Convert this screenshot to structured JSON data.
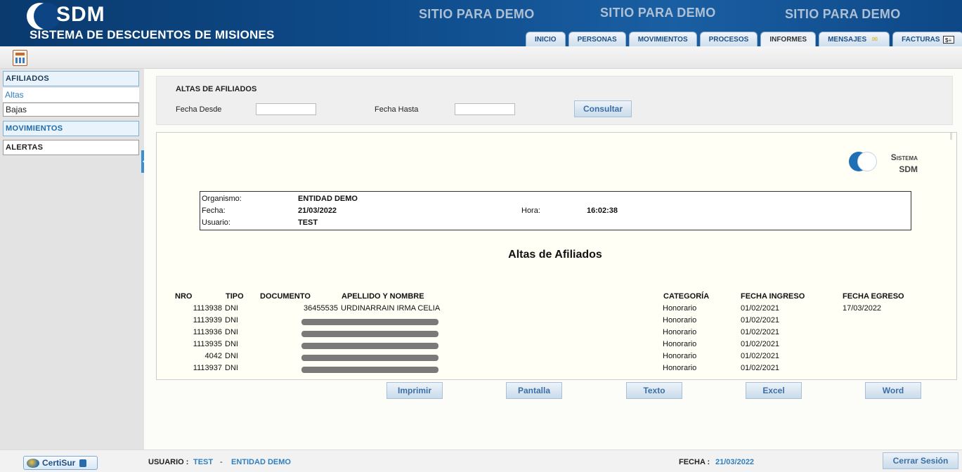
{
  "header": {
    "logo_text": "SDM",
    "subtitle": "SISTEMA DE DESCUENTOS DE MISIONES",
    "demo_banners": [
      "SITIO PARA DEMO",
      "SITIO PARA DEMO",
      "SITIO PARA DEMO"
    ],
    "tabs": [
      {
        "label": "INICIO",
        "active": false
      },
      {
        "label": "PERSONAS",
        "active": false
      },
      {
        "label": "MOVIMIENTOS",
        "active": false
      },
      {
        "label": "PROCESOS",
        "active": false
      },
      {
        "label": "INFORMES",
        "active": true
      },
      {
        "label": "MENSAJES",
        "active": false,
        "icon": "envelope-icon"
      },
      {
        "label": "FACTURAS",
        "active": false,
        "icon": "invoice-icon"
      }
    ]
  },
  "toolbar": {
    "icon": "report-icon"
  },
  "sidebar": {
    "afiliados_header": "AFILIADOS",
    "items": [
      "Altas",
      "Bajas"
    ],
    "movimientos_header": "MOVIMIENTOS",
    "alertas_header": "ALERTAS"
  },
  "filter": {
    "title": "ALTAS DE AFILIADOS",
    "desde_label": "Fecha Desde",
    "desde_value": "",
    "hasta_label": "Fecha Hasta",
    "hasta_value": "",
    "consultar_label": "Consultar"
  },
  "report": {
    "logo_line1": "Sistema",
    "logo_line2": "SDM",
    "organismo_label": "Organismo:",
    "organismo_value": "ENTIDAD DEMO",
    "fecha_label": "Fecha:",
    "fecha_value": "21/03/2022",
    "hora_label": "Hora:",
    "hora_value": "16:02:38",
    "usuario_label": "Usuario:",
    "usuario_value": "TEST",
    "title": "Altas de Afiliados",
    "columns": {
      "nro": "NRO",
      "tipo": "TIPO",
      "documento": "DOCUMENTO",
      "apellido": "APELLIDO Y NOMBRE",
      "categoria": "CATEGORÍA",
      "ingreso": "FECHA INGRESO",
      "egreso": "FECHA EGRESO"
    },
    "rows": [
      {
        "nro": "1113938",
        "tipo": "DNI",
        "documento": "36455535",
        "nombre": "URDINARRAIN IRMA CELIA",
        "categoria": "Honorario",
        "ingreso": "01/02/2021",
        "egreso": "17/03/2022",
        "redacted": false
      },
      {
        "nro": "1113939",
        "tipo": "DNI",
        "documento": "",
        "nombre": "",
        "categoria": "Honorario",
        "ingreso": "01/02/2021",
        "egreso": "",
        "redacted": true
      },
      {
        "nro": "1113936",
        "tipo": "DNI",
        "documento": "",
        "nombre": "",
        "categoria": "Honorario",
        "ingreso": "01/02/2021",
        "egreso": "",
        "redacted": true
      },
      {
        "nro": "1113935",
        "tipo": "DNI",
        "documento": "",
        "nombre": "",
        "categoria": "Honorario",
        "ingreso": "01/02/2021",
        "egreso": "",
        "redacted": true
      },
      {
        "nro": "4042",
        "tipo": "DNI",
        "documento": "",
        "nombre": "",
        "categoria": "Honorario",
        "ingreso": "01/02/2021",
        "egreso": "",
        "redacted": true
      },
      {
        "nro": "1113937",
        "tipo": "DNI",
        "documento": "",
        "nombre": "",
        "categoria": "Honorario",
        "ingreso": "01/02/2021",
        "egreso": "",
        "redacted": true
      }
    ]
  },
  "actions": [
    "Imprimir",
    "Pantalla",
    "Texto",
    "Excel",
    "Word"
  ],
  "footer": {
    "brand": "CertiSur",
    "usuario_label": "USUARIO :",
    "usuario_value": "TEST",
    "separator": "-",
    "entidad_value": "ENTIDAD DEMO",
    "fecha_label": "FECHA :",
    "fecha_value": "21/03/2022",
    "logout_label": "Cerrar Sesión"
  }
}
